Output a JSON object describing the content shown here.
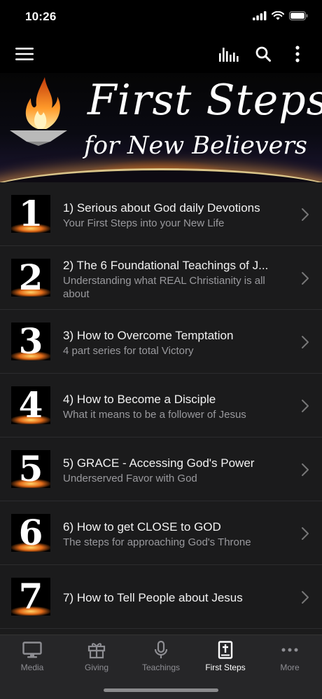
{
  "status_bar": {
    "time": "10:26"
  },
  "banner": {
    "title_line1": "First Steps",
    "title_line2": "for New Believers"
  },
  "items": [
    {
      "number": "1",
      "title": "1) Serious about God daily Devotions",
      "subtitle": "Your First Steps into your New Life"
    },
    {
      "number": "2",
      "title": "2) The 6 Foundational Teachings of J...",
      "subtitle": "Understanding what REAL Christianity is all about"
    },
    {
      "number": "3",
      "title": "3) How to Overcome Temptation",
      "subtitle": "4 part series for total Victory"
    },
    {
      "number": "4",
      "title": "4) How to Become a Disciple",
      "subtitle": "What it means to be a follower of Jesus"
    },
    {
      "number": "5",
      "title": "5) GRACE - Accessing God's Power",
      "subtitle": "Underserved Favor with God"
    },
    {
      "number": "6",
      "title": "6) How to get CLOSE to GOD",
      "subtitle": "The steps for approaching God's Throne"
    },
    {
      "number": "7",
      "title": "7) How to Tell People about Jesus",
      "subtitle": ""
    }
  ],
  "tabs": [
    {
      "label": "Media",
      "icon": "monitor-icon"
    },
    {
      "label": "Giving",
      "icon": "gift-icon"
    },
    {
      "label": "Teachings",
      "icon": "microphone-icon"
    },
    {
      "label": "First Steps",
      "icon": "bible-icon"
    },
    {
      "label": "More",
      "icon": "more-dots-icon"
    }
  ],
  "colors": {
    "background": "#1b1b1c",
    "active_tab": "#ffffff",
    "inactive_tab": "#8e8e93"
  }
}
